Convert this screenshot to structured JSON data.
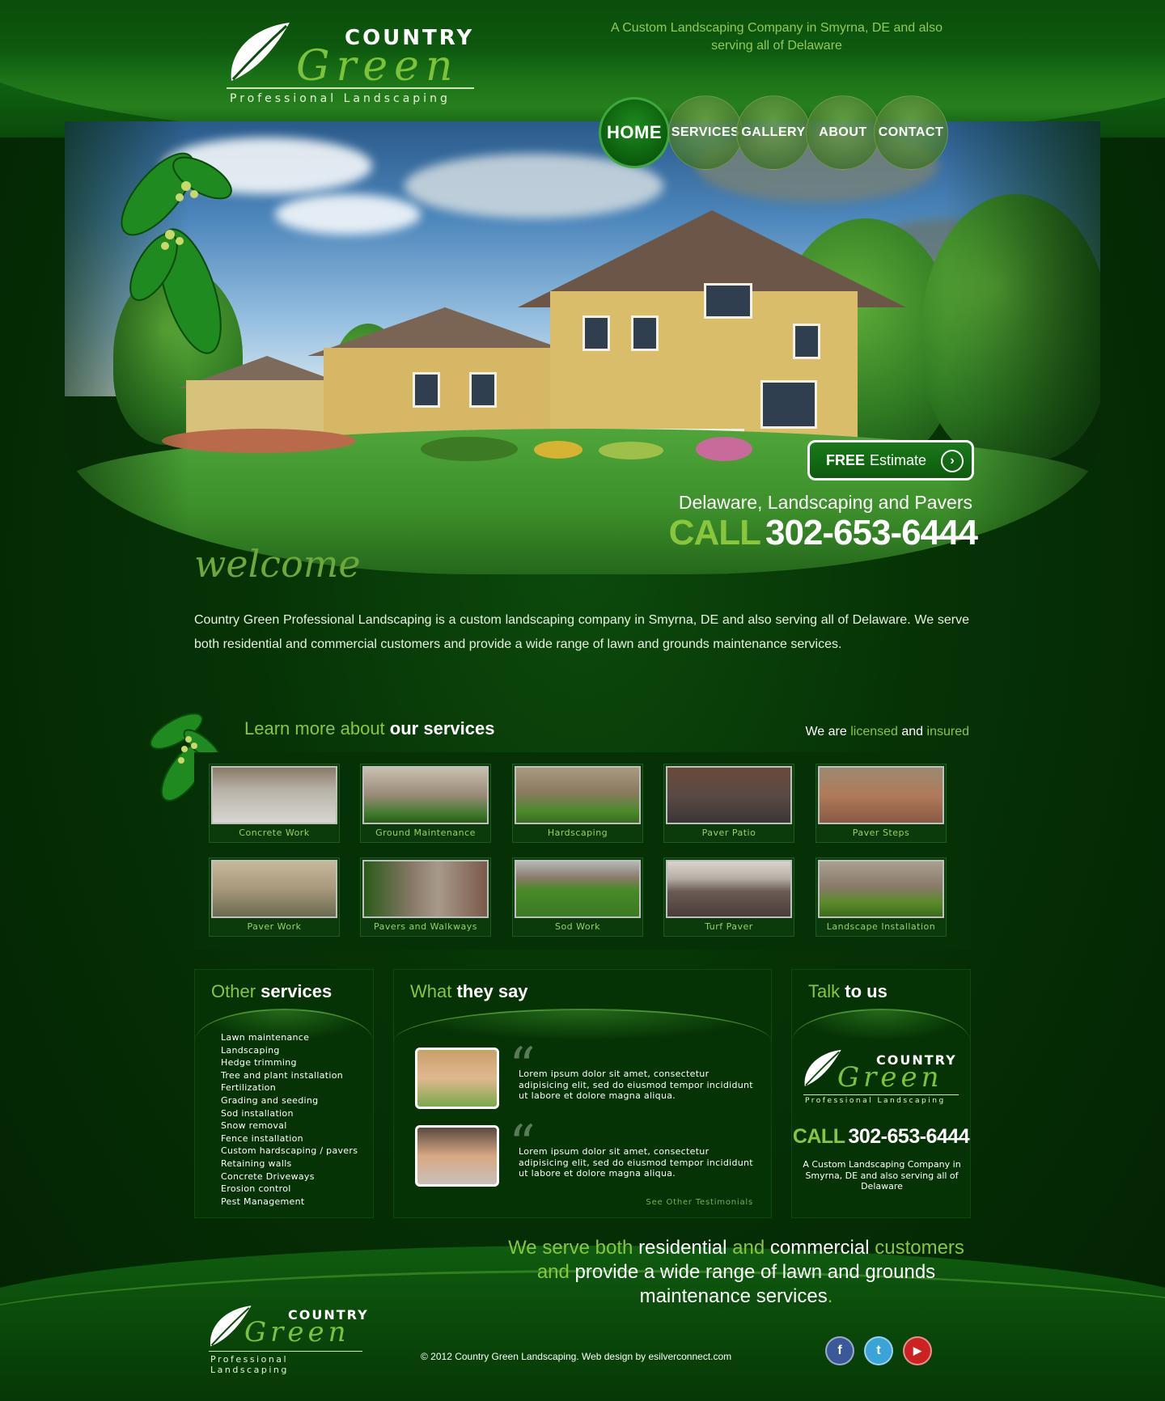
{
  "header": {
    "logo": {
      "country": "COUNTRY",
      "green": "Green",
      "subtitle": "Professional Landscaping"
    },
    "tagline": "A Custom Landscaping Company in Smyrna, DE and also serving all of Delaware"
  },
  "nav": {
    "items": [
      {
        "label": "HOME",
        "active": true
      },
      {
        "label": "SERVICES"
      },
      {
        "label": "GALLERY"
      },
      {
        "label": "ABOUT"
      },
      {
        "label": "CONTACT"
      }
    ]
  },
  "hero": {
    "free_bold": "FREE",
    "free_rest": "Estimate",
    "arrow_icon": "chevron-right-icon",
    "line": "Delaware, Landscaping and Pavers",
    "call_label": "CALL",
    "phone": "302-653-6444"
  },
  "welcome": {
    "title": "welcome",
    "text": "Country Green Professional Landscaping is a custom landscaping company in Smyrna, DE and also serving all of Delaware. We serve both residential and commercial customers and provide a wide range of lawn and grounds maintenance services."
  },
  "services": {
    "title_light": "Learn more about",
    "title_bold": "our services",
    "licensed_pre": "We are",
    "licensed_word": "licensed",
    "licensed_and": "and",
    "insured_word": "insured",
    "tiles": [
      "Concrete Work",
      "Ground Maintenance",
      "Hardscaping",
      "Paver Patio",
      "Paver Steps",
      "Paver Work",
      "Pavers and Walkways",
      "Sod Work",
      "Turf Paver",
      "Landscape Installation"
    ]
  },
  "other_services": {
    "title_light": "Other",
    "title_bold": "services",
    "items": [
      "Lawn maintenance",
      "Landscaping",
      "Hedge trimming",
      "Tree and plant installation",
      "Fertilization",
      "Grading and seeding",
      "Sod installation",
      "Snow removal",
      "Fence installation",
      "Custom hardscaping / pavers",
      "Retaining walls",
      "Concrete Driveways",
      "Erosion control",
      "Pest Management"
    ]
  },
  "testimonials": {
    "title_light": "What",
    "title_bold": "they say",
    "items": [
      {
        "text": "Lorem ipsum dolor sit amet, consectetur adipisicing elit, sed do eiusmod tempor incididunt ut labore et dolore magna aliqua."
      },
      {
        "text": "Lorem ipsum dolor sit amet, consectetur adipisicing elit, sed do eiusmod tempor incididunt ut labore et dolore magna aliqua."
      }
    ],
    "see_other": "See Other Testimonials"
  },
  "talk": {
    "title_light": "Talk",
    "title_bold": "to us",
    "call_label": "CALL",
    "phone": "302-653-6444",
    "text": "A Custom Landscaping Company in Smyrna, DE and also serving all of Delaware"
  },
  "footer": {
    "serve": {
      "p1": "We serve both",
      "p2": "residential",
      "p3": "and",
      "p4": "commercial",
      "p5": "customers",
      "p6": "and",
      "p7": "provide a wide range of lawn and grounds maintenance services",
      "p8": "."
    },
    "copyright": "© 2012 Country Green Landscaping. Web design by esilverconnect.com",
    "social": [
      {
        "icon": "facebook-icon",
        "glyph": "f",
        "color": "#3b5998"
      },
      {
        "icon": "twitter-icon",
        "glyph": "t",
        "color": "#3aa3d8"
      },
      {
        "icon": "youtube-icon",
        "glyph": "▶",
        "color": "#cc2222"
      }
    ]
  },
  "colors": {
    "accent": "#8ac53e",
    "background": "#042804"
  }
}
